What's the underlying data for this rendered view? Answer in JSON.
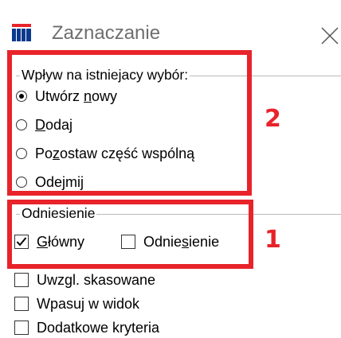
{
  "window": {
    "title": "Zaznaczanie",
    "app_icon": "grid-building-icon",
    "close_icon": "close-icon"
  },
  "influence_group": {
    "legend": "Wpływ na istniejacy wybór:",
    "options": [
      {
        "pre": "Utwórz ",
        "ul": "n",
        "post": "owy",
        "selected": true
      },
      {
        "pre": "",
        "ul": "D",
        "post": "odaj",
        "selected": false
      },
      {
        "pre": "Po",
        "ul": "z",
        "post": "ostaw część wspólną",
        "selected": false
      },
      {
        "pre": "Ode",
        "ul": "j",
        "post": "mij",
        "selected": false
      }
    ]
  },
  "reference_group": {
    "legend": "Odniesienie",
    "main": {
      "pre": "",
      "ul": "G",
      "post": "łówny",
      "checked": true
    },
    "reference": {
      "pre": "Odnie",
      "ul": "s",
      "post": "ienie",
      "checked": false
    }
  },
  "extra_checkboxes": [
    {
      "label": "Uwzgl. skasowane",
      "checked": false
    },
    {
      "label": "Wpasuj w widok",
      "checked": false
    },
    {
      "label": "Dodatkowe kryteria",
      "checked": false
    }
  ],
  "annotations": {
    "number_1": "1",
    "number_2": "2",
    "color": "#e8232a"
  }
}
